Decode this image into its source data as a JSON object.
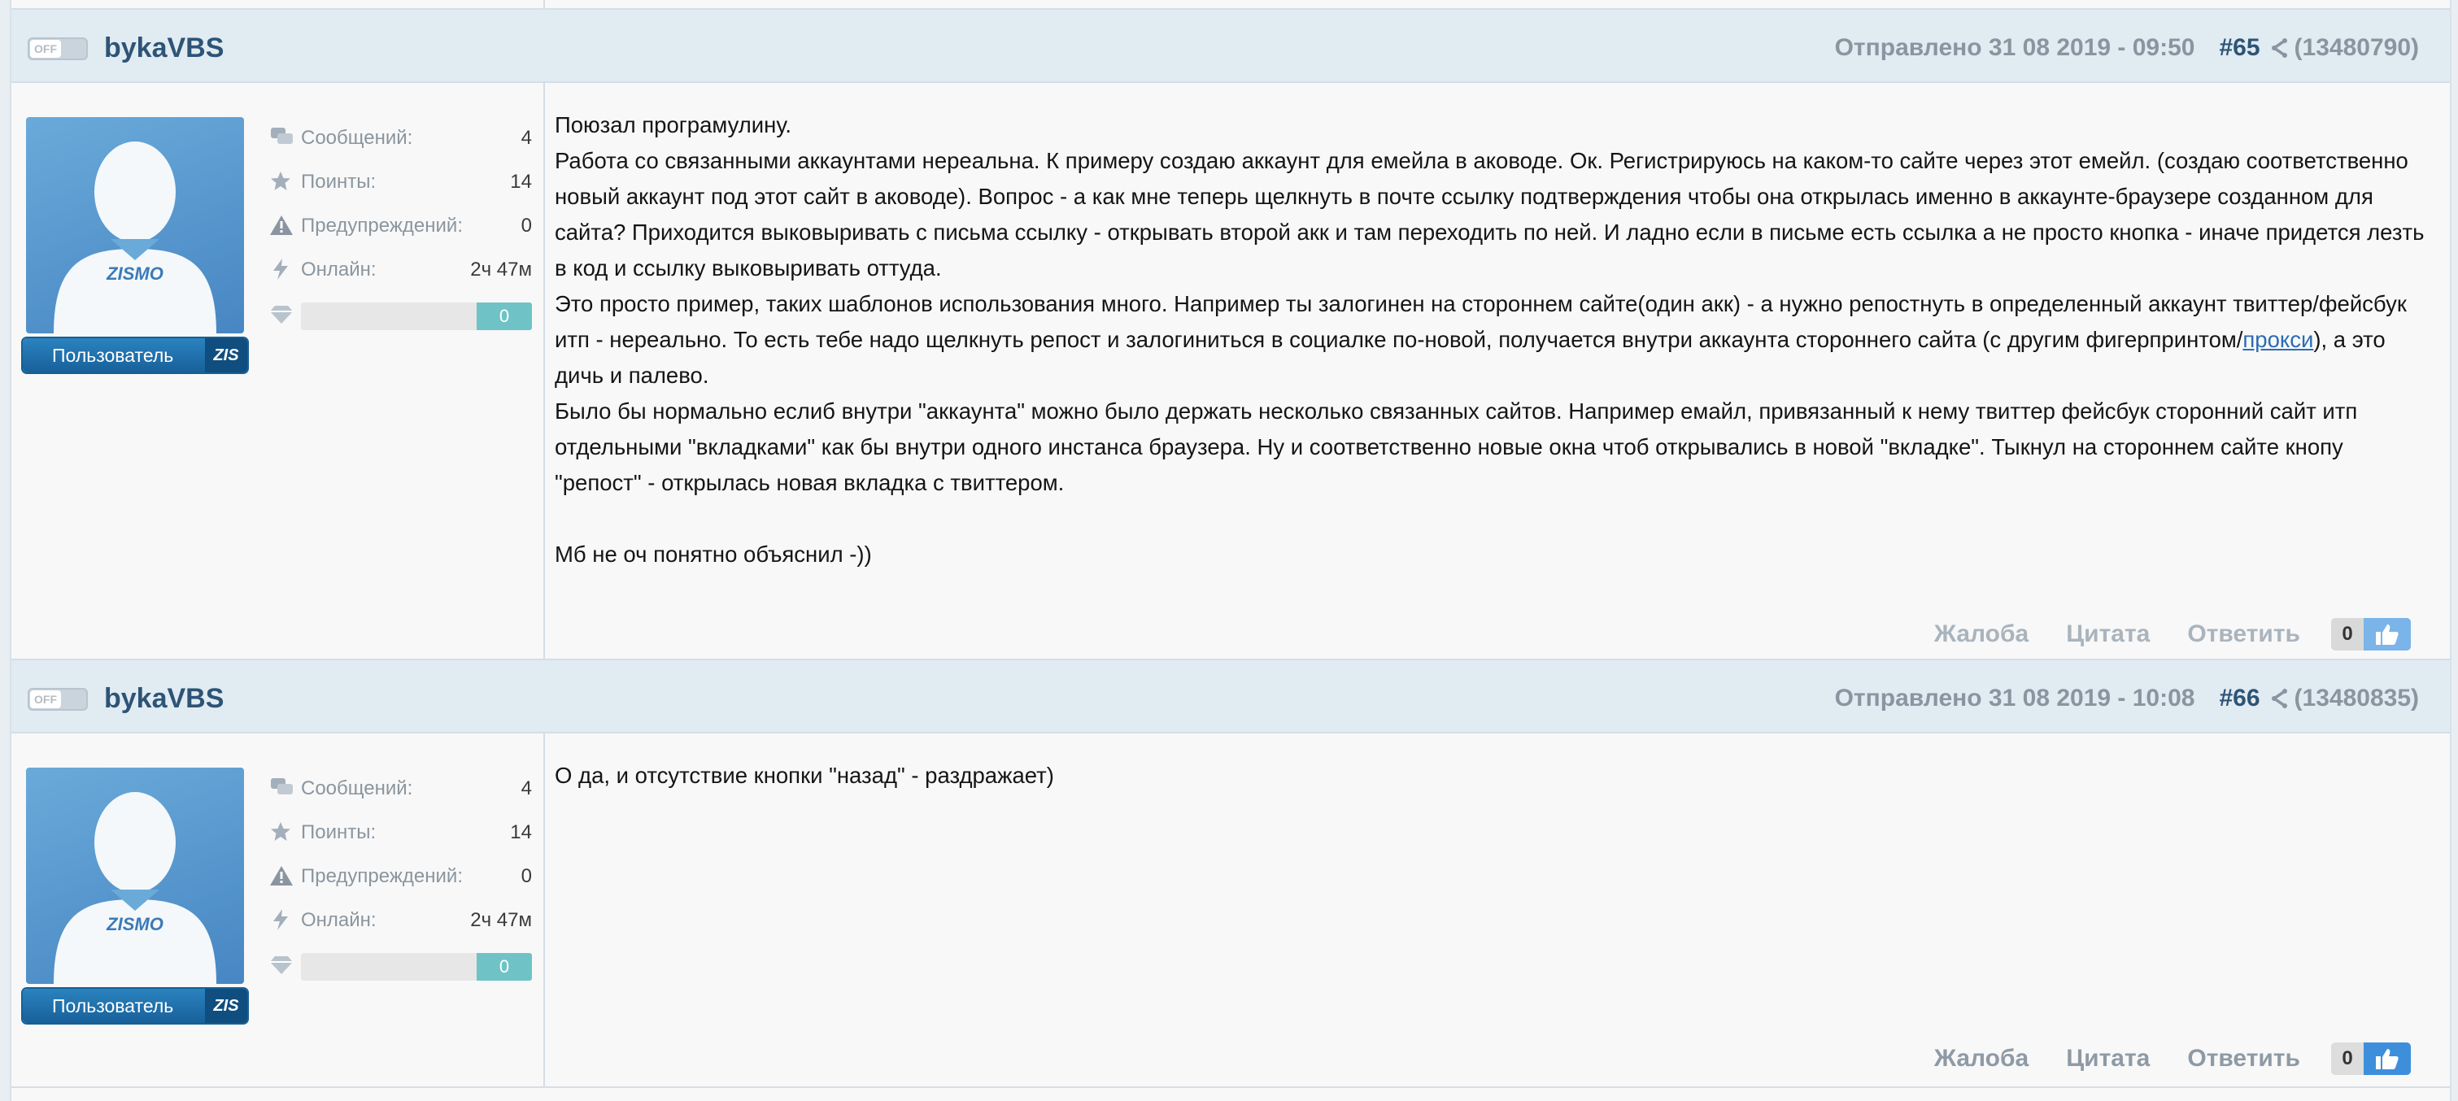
{
  "labels": {
    "messages": "Сообщений:",
    "points": "Поинты:",
    "warnings": "Предупреждений:",
    "online": "Онлайн:",
    "toggle_off": "OFF",
    "avatar_text": "ZISMO",
    "role": "Пользователь",
    "role_tag": "ZIS",
    "report": "Жалоба",
    "quote": "Цитата",
    "reply": "Ответить"
  },
  "posts": [
    {
      "username": "bykaVBS",
      "sent": "Отправлено 31 08 2019 - 09:50",
      "number": "#65",
      "post_id": "(13480790)",
      "stats": {
        "messages": "4",
        "points": "14",
        "warnings": "0",
        "online": "2ч 47м",
        "reputation": "0"
      },
      "likes": "0",
      "content": {
        "p1": "Поюзал програмулину.",
        "p2": "Работа со связанными аккаунтами нереальна. К примеру создаю аккаунт для емейла в аководе. Ок. Регистрируюсь на каком-то сайте через этот емейл. (создаю соответственно новый аккаунт под этот сайт в аководе). Вопрос - а как мне теперь щелкнуть в почте ссылку подтверждения чтобы она открылась именно в аккаунте-браузере созданном для сайта? Приходится выковыривать с письма ссылку - открывать второй акк и там переходить по ней. И ладно если в письме есть ссылка а не просто кнопка - иначе придется лезть в код и ссылку выковыривать оттуда.",
        "p3_before": "Это просто пример, таких шаблонов использования много. Например ты залогинен на стороннем сайте(один акк) - а нужно репостнуть в определенный аккаунт твиттер/фейсбук итп - нереально. То есть тебе надо щелкнуть репост и залогиниться в социалке по-новой, получается внутри аккаунта стороннего сайта (с другим фигерпринтом/",
        "p3_link": "прокси",
        "p3_after": "), а это дичь и палево.",
        "p4": "Было бы нормально еслиб внутри \"аккаунта\" можно было держать несколько связанных сайтов. Например емайл, привязанный к нему твиттер фейсбук сторонний сайт итп отдельными \"вкладками\" как бы внутри одного инстанса браузера. Ну и соответственно новые окна чтоб открывались в новой \"вкладке\". Тыкнул на стороннем сайте кнопу \"репост\" - открылась новая вкладка с твиттером.",
        "p5": "Мб не оч понятно объяснил -))"
      }
    },
    {
      "username": "bykaVBS",
      "sent": "Отправлено 31 08 2019 - 10:08",
      "number": "#66",
      "post_id": "(13480835)",
      "stats": {
        "messages": "4",
        "points": "14",
        "warnings": "0",
        "online": "2ч 47м",
        "reputation": "0"
      },
      "likes": "0",
      "content": {
        "p1": "О да, и отсутствие кнопки \"назад\" - раздражает)"
      }
    }
  ]
}
